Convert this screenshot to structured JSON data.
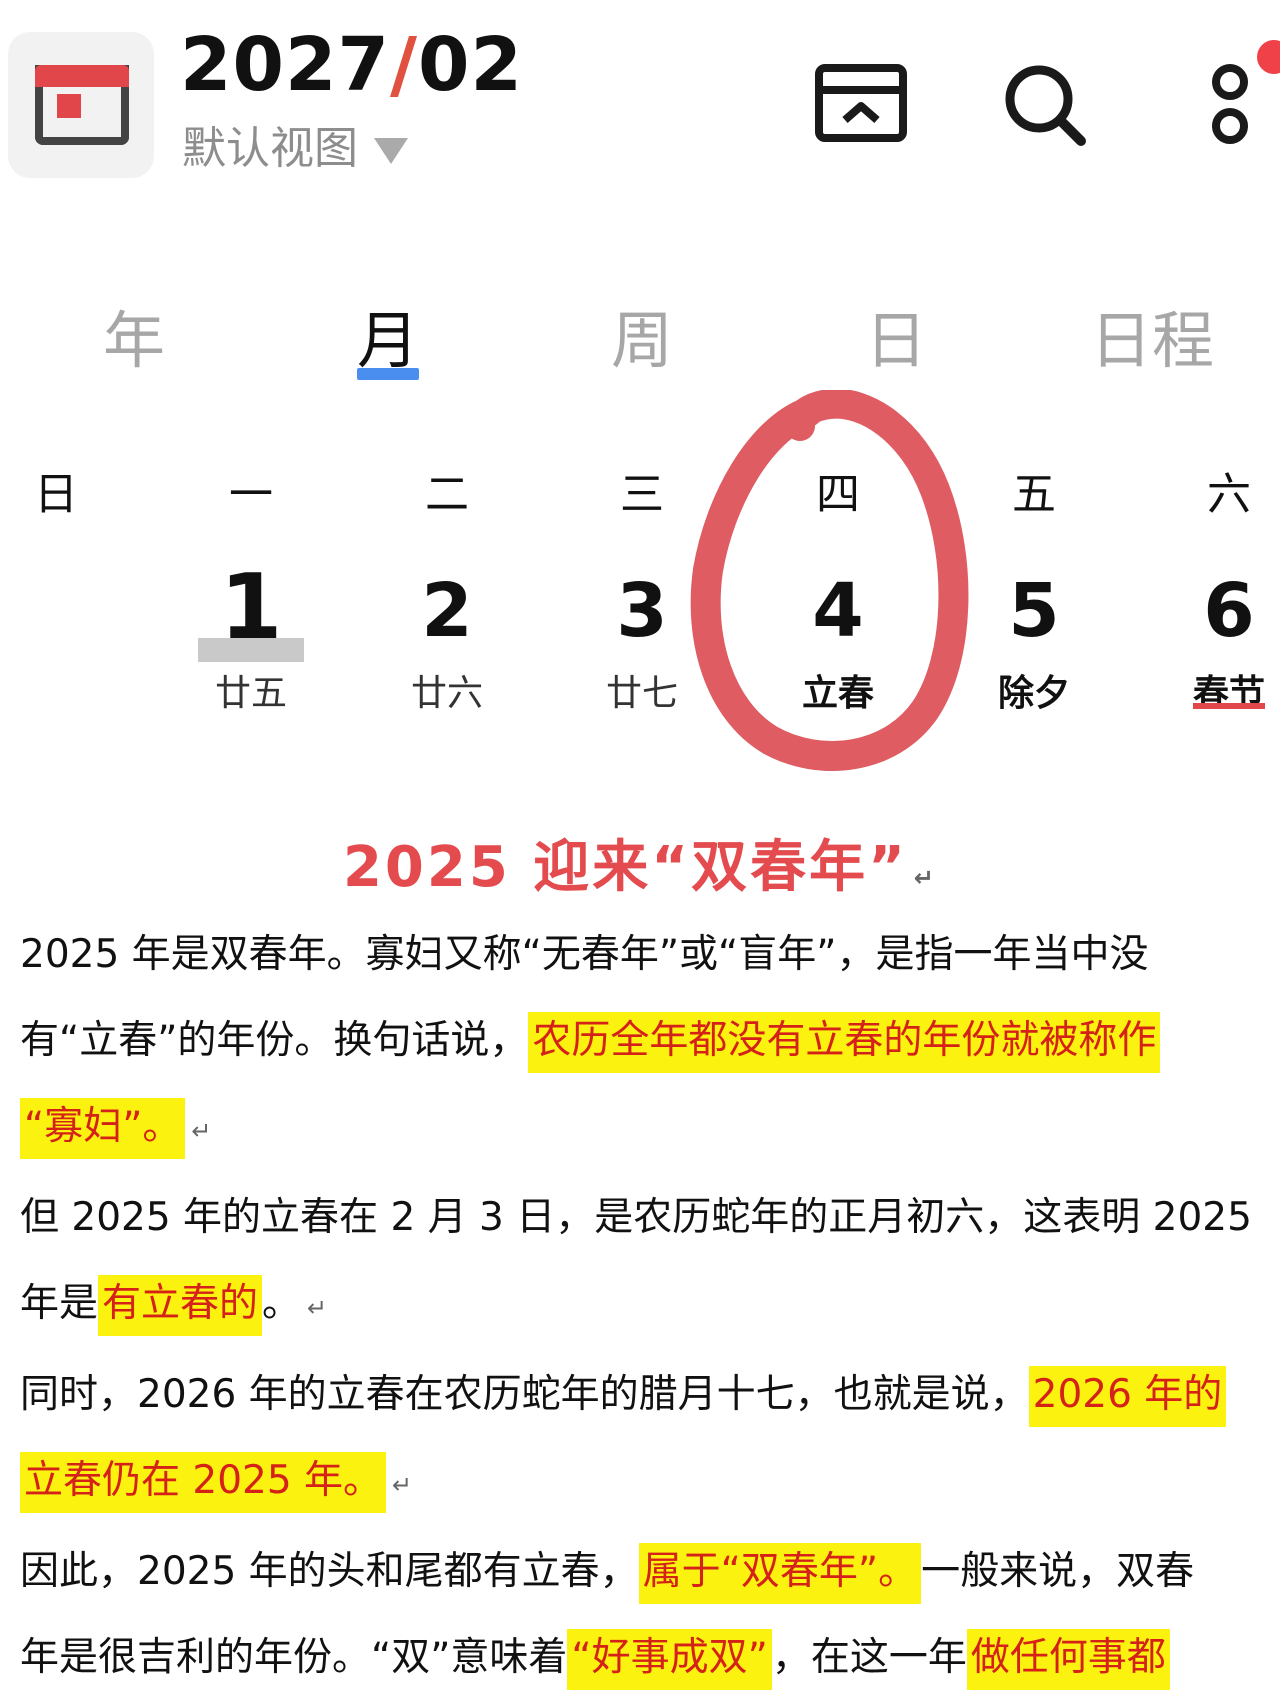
{
  "header": {
    "year_month_year": "2027",
    "year_month_sep": "/",
    "year_month_month": "02",
    "view_selector": "默认视图"
  },
  "tabs": [
    {
      "label": "年",
      "active": false
    },
    {
      "label": "月",
      "active": true
    },
    {
      "label": "周",
      "active": false
    },
    {
      "label": "日",
      "active": false
    },
    {
      "label": "日程",
      "active": false
    }
  ],
  "weekdays": [
    "日",
    "一",
    "二",
    "三",
    "四",
    "五",
    "六"
  ],
  "days": [
    {
      "num": "1",
      "lunar": "廿五",
      "today": true
    },
    {
      "num": "2",
      "lunar": "廿六"
    },
    {
      "num": "3",
      "lunar": "廿七"
    },
    {
      "num": "4",
      "lunar": "立春",
      "festival": true,
      "circled": true
    },
    {
      "num": "5",
      "lunar": "除夕",
      "festival": true
    },
    {
      "num": "6",
      "lunar": "春节",
      "festival": true
    }
  ],
  "colors": {
    "accent_red": "#e0464a",
    "tab_underline": "#4a8ff0",
    "highlight_bg": "#fcf20f",
    "highlight_text": "#d42219",
    "article_title": "#e34b4e"
  },
  "icons": [
    "calendar-app-icon",
    "archive-box-icon",
    "search-icon",
    "more-dots-icon",
    "notification-dot"
  ],
  "article": {
    "title": "2025 迎来“双春年”",
    "lines": [
      [
        {
          "t": "2025 年是双春年。寡妇又称“无春年”或“盲年”，是指一年当中没"
        }
      ],
      [
        {
          "t": "有“立春”的年份。换句话说，"
        },
        {
          "t": "农历全年都没有立春的年份就被称作",
          "hl": true
        }
      ],
      [
        {
          "t": "“寡妇”。",
          "hl": true
        }
      ],
      [
        {
          "t": "但 2025 年的立春在 2 月 3 日，是农历蛇年的正月初六，这表明 2025"
        }
      ],
      [
        {
          "t": "年是"
        },
        {
          "t": "有立春的",
          "hl": true
        },
        {
          "t": "。"
        }
      ],
      [
        {
          "t": "同时，2026 年的立春在农历蛇年的腊月十七，也就是说，"
        },
        {
          "t": "2026 年的",
          "hl": true
        }
      ],
      [
        {
          "t": "立春仍在 2025 年。",
          "hl": true
        }
      ],
      [
        {
          "t": "因此，2025 年的头和尾都有立春，"
        },
        {
          "t": "属于“双春年”。",
          "hl": true
        },
        {
          "t": "一般来说，双春"
        }
      ],
      [
        {
          "t": "年是很吉利的年份。“双”意味着"
        },
        {
          "t": "“好事成双”",
          "hl": true
        },
        {
          "t": "，在这一年"
        },
        {
          "t": "做任何事都",
          "hl": true
        }
      ]
    ]
  }
}
